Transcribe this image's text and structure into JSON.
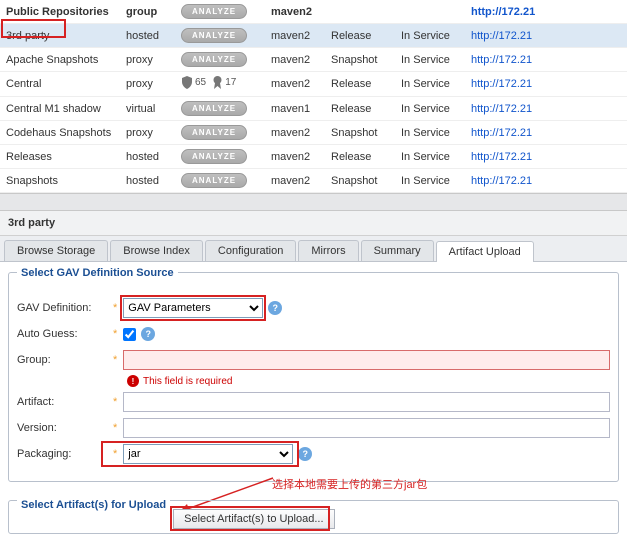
{
  "table": {
    "header": {
      "name": "Public Repositories",
      "type": "group",
      "fmt": "maven2",
      "url": "http://172.21"
    },
    "rows": [
      {
        "name": "3rd party",
        "type": "hosted",
        "health": "analyze",
        "fmt": "maven2",
        "pol": "Release",
        "status": "In Service",
        "url": "http://172.21"
      },
      {
        "name": "Apache Snapshots",
        "type": "proxy",
        "health": "analyze",
        "fmt": "maven2",
        "pol": "Snapshot",
        "status": "In Service",
        "url": "http://172.21"
      },
      {
        "name": "Central",
        "type": "proxy",
        "health": "badges",
        "shield": "65",
        "ribbon": "17",
        "fmt": "maven2",
        "pol": "Release",
        "status": "In Service",
        "url": "http://172.21"
      },
      {
        "name": "Central M1 shadow",
        "type": "virtual",
        "health": "analyze",
        "fmt": "maven1",
        "pol": "Release",
        "status": "In Service",
        "url": "http://172.21"
      },
      {
        "name": "Codehaus Snapshots",
        "type": "proxy",
        "health": "analyze",
        "fmt": "maven2",
        "pol": "Snapshot",
        "status": "In Service",
        "url": "http://172.21"
      },
      {
        "name": "Releases",
        "type": "hosted",
        "health": "analyze",
        "fmt": "maven2",
        "pol": "Release",
        "status": "In Service",
        "url": "http://172.21"
      },
      {
        "name": "Snapshots",
        "type": "hosted",
        "health": "analyze",
        "fmt": "maven2",
        "pol": "Snapshot",
        "status": "In Service",
        "url": "http://172.21"
      }
    ],
    "analyze_label": "ANALYZE"
  },
  "panel_title": "3rd party",
  "tabs": [
    "Browse Storage",
    "Browse Index",
    "Configuration",
    "Mirrors",
    "Summary",
    "Artifact Upload"
  ],
  "active_tab": 5,
  "gav": {
    "legend": "Select GAV Definition Source",
    "def_label": "GAV Definition:",
    "def_value": "GAV Parameters",
    "auto_label": "Auto Guess:",
    "auto_checked": true,
    "group_label": "Group:",
    "group_value": "",
    "err_text": "This field is required",
    "artifact_label": "Artifact:",
    "artifact_value": "",
    "version_label": "Version:",
    "version_value": "",
    "packaging_label": "Packaging:",
    "packaging_value": "jar"
  },
  "upload": {
    "legend": "Select Artifact(s) for Upload",
    "btn": "Select Artifact(s) to Upload..."
  },
  "annotation": "选择本地需要上传的第三方jar包"
}
